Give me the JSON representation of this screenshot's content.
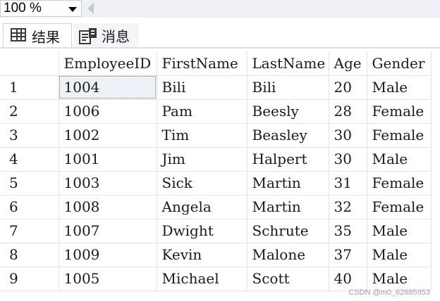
{
  "toolbar": {
    "zoom_value": "100 %"
  },
  "tabs": {
    "results_label": "结果",
    "messages_label": "消息"
  },
  "grid": {
    "columns": [
      "EmployeeID",
      "FirstName",
      "LastName",
      "Age",
      "Gender"
    ],
    "rows": [
      {
        "n": "1",
        "cells": [
          "1004",
          "Bili",
          "Bili",
          "20",
          "Male"
        ]
      },
      {
        "n": "2",
        "cells": [
          "1006",
          "Pam",
          "Beesly",
          "28",
          "Female"
        ]
      },
      {
        "n": "3",
        "cells": [
          "1002",
          "Tim",
          "Beasley",
          "30",
          "Female"
        ]
      },
      {
        "n": "4",
        "cells": [
          "1001",
          "Jim",
          "Halpert",
          "30",
          "Male"
        ]
      },
      {
        "n": "5",
        "cells": [
          "1003",
          "Sick",
          "Martin",
          "31",
          "Female"
        ]
      },
      {
        "n": "6",
        "cells": [
          "1008",
          "Angela",
          "Martin",
          "32",
          "Female"
        ]
      },
      {
        "n": "7",
        "cells": [
          "1007",
          "Dwight",
          "Schrute",
          "35",
          "Male"
        ]
      },
      {
        "n": "8",
        "cells": [
          "1009",
          "Kevin",
          "Malone",
          "37",
          "Male"
        ]
      },
      {
        "n": "9",
        "cells": [
          "1005",
          "Michael",
          "Scott",
          "40",
          "Male"
        ]
      }
    ]
  },
  "watermark": "CSDN @m0_62685953"
}
